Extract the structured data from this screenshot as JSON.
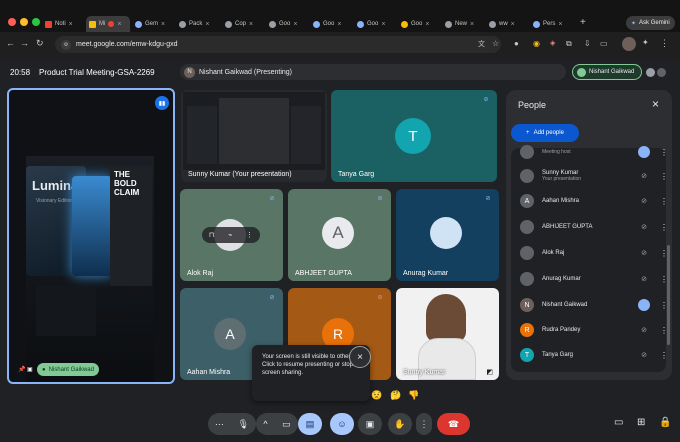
{
  "browser": {
    "tabs": [
      {
        "label": "Noti"
      },
      {
        "label": "Mi",
        "active": true
      },
      {
        "label": "Gem"
      },
      {
        "label": "Pack"
      },
      {
        "label": "Cop"
      },
      {
        "label": "Goo"
      },
      {
        "label": "Goo"
      },
      {
        "label": "Goo"
      },
      {
        "label": "Goo"
      },
      {
        "label": "New"
      },
      {
        "label": "ww"
      },
      {
        "label": "Pers"
      }
    ],
    "ask_label": "Ask Gemini",
    "url": "meet.google.com/emw-kdgu-gxd"
  },
  "meeting": {
    "time": "20:58",
    "title": "Product Trial Meeting-GSA-2269",
    "presenting_chip": "Nishant Gaikwad (Presenting)",
    "presenter_avatar_letter": "N",
    "self_chip": "Nishant Gaikwad"
  },
  "tiles": {
    "presentation": {
      "brand": "Lumina X",
      "edition": "Visionary Edition",
      "claim": "THE BOLD CLAIM",
      "name": "Nishant Gaikwad"
    },
    "sunny": {
      "name": "Sunny Kumar (Your presentation)"
    },
    "tanya": {
      "name": "Tanya Garg",
      "letter": "T"
    },
    "alok": {
      "name": "Alok Raj"
    },
    "abhijeet": {
      "name": "ABHJEET GUPTA",
      "letter": "A"
    },
    "anurag": {
      "name": "Anurag Kumar"
    },
    "aahan": {
      "name": "Aahan Mishra",
      "letter": "A"
    },
    "rudra": {
      "letter": "R"
    },
    "sunnycam": {
      "name": "Sunny Kumar"
    }
  },
  "toast": {
    "text": "Your screen is still visible to others. Click to resume presenting or stop screen sharing."
  },
  "reactions": [
    "😟",
    "🤔",
    "👎"
  ],
  "people_panel": {
    "title": "People",
    "add_label": "Add people",
    "list": [
      {
        "name": "",
        "sub": "Meeting host",
        "letter": "",
        "color": "#5f6368"
      },
      {
        "name": "Sunny Kumar",
        "sub": "Your presentation",
        "letter": "",
        "color": "#5f6368"
      },
      {
        "name": "Aahan Mishra",
        "sub": "",
        "letter": "A",
        "color": "#5f6368"
      },
      {
        "name": "ABHIJEET GUPTA",
        "sub": "",
        "letter": "",
        "color": "#5f6368"
      },
      {
        "name": "Alok Raj",
        "sub": "",
        "letter": "",
        "color": "#5f6368"
      },
      {
        "name": "Anurag Kumar",
        "sub": "",
        "letter": "",
        "color": "#5f6368"
      },
      {
        "name": "Nishant Gaikwad",
        "sub": "",
        "letter": "N",
        "color": "#6d5f5a"
      },
      {
        "name": "Rudra Pandey",
        "sub": "",
        "letter": "R",
        "color": "#e8710a"
      },
      {
        "name": "Tanya Garg",
        "sub": "",
        "letter": "T",
        "color": "#12a4af"
      }
    ]
  }
}
